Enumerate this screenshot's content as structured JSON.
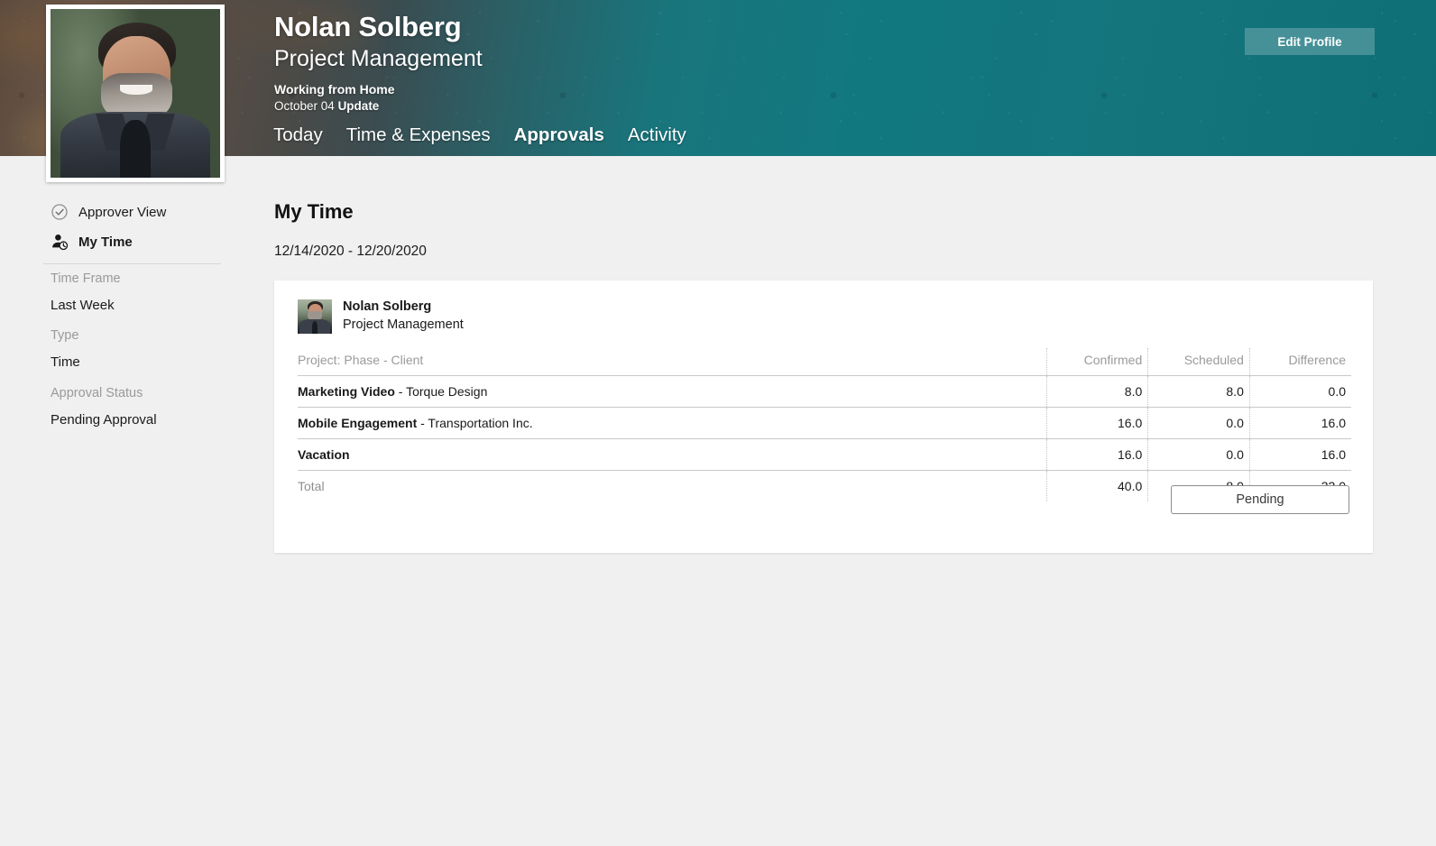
{
  "header": {
    "name": "Nolan Solberg",
    "role": "Project Management",
    "status": "Working from Home",
    "update_date": "October 04",
    "update_link": "Update",
    "edit_profile_label": "Edit Profile",
    "accent_teal": "#127880",
    "tabs": [
      {
        "label": "Today",
        "active": false
      },
      {
        "label": "Time & Expenses",
        "active": false
      },
      {
        "label": "Approvals",
        "active": true
      },
      {
        "label": "Activity",
        "active": false
      }
    ]
  },
  "sidebar": {
    "views": [
      {
        "label": "Approver View",
        "icon": "check-circle-icon",
        "selected": false
      },
      {
        "label": "My Time",
        "icon": "person-clock-icon",
        "selected": true
      }
    ],
    "filters": [
      {
        "label": "Time Frame",
        "value": "Last Week"
      },
      {
        "label": "Type",
        "value": "Time"
      },
      {
        "label": "Approval Status",
        "value": "Pending Approval"
      }
    ]
  },
  "main": {
    "title": "My Time",
    "date_range": "12/14/2020 - 12/20/2020",
    "card": {
      "person_name": "Nolan Solberg",
      "person_role": "Project Management",
      "columns": [
        "Project: Phase - Client",
        "Confirmed",
        "Scheduled",
        "Difference"
      ],
      "rows": [
        {
          "project": "Marketing Video",
          "client": " - Torque Design",
          "confirmed": "8.0",
          "scheduled": "8.0",
          "difference": "0.0"
        },
        {
          "project": "Mobile Engagement",
          "client": " - Transportation Inc.",
          "confirmed": "16.0",
          "scheduled": "0.0",
          "difference": "16.0"
        },
        {
          "project": "Vacation",
          "client": "",
          "confirmed": "16.0",
          "scheduled": "0.0",
          "difference": "16.0"
        }
      ],
      "total": {
        "label": "Total",
        "confirmed": "40.0",
        "scheduled": "8.0",
        "difference": "32.0"
      },
      "action_label": "Pending"
    }
  }
}
